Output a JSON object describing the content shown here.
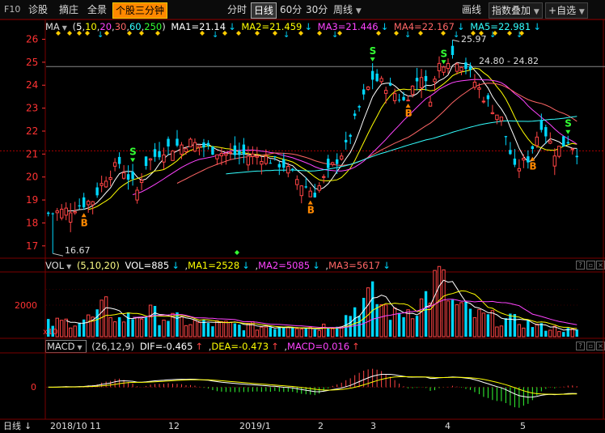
{
  "topbar": {
    "f10": "F10",
    "left_tabs": [
      "诊股",
      "摘庄",
      "全景"
    ],
    "active_tab": "个股三分钟",
    "periods": [
      "分时",
      "日线",
      "60分",
      "30分",
      "周线"
    ],
    "selected_period": "日线",
    "draw_label": "画线",
    "overlay_label": "指数叠加",
    "watchlist_label": "自选"
  },
  "colors": {
    "up": "#ff4444",
    "down": "#00d8ff",
    "ma5": "#ffffff",
    "ma10": "#ffff00",
    "ma20": "#ff44ff",
    "ma30": "#ff6666",
    "ma60": "#33ffff",
    "ma250": "#33ff33",
    "grid": "#7a0000",
    "axis_text": "#ff3333",
    "buy": "#ff8800",
    "sell": "#33ff33"
  },
  "price_panel": {
    "name": "MA",
    "params_prefix": "(",
    "params": [
      "5",
      "10",
      "20",
      "30",
      "60",
      "250"
    ],
    "params_suffix": ")",
    "ma_values": [
      {
        "label": "MA1=21.14"
      },
      {
        "label": "MA2=21.459"
      },
      {
        "label": "MA3=21.446"
      },
      {
        "label": "MA4=22.167"
      },
      {
        "label": "MA5=22.981"
      }
    ],
    "y_ticks": [
      "26",
      "25",
      "24",
      "23",
      "22",
      "21",
      "20",
      "19",
      "18",
      "17"
    ],
    "high_label": "25.97",
    "low_label": "16.67",
    "range_label": "24.80 - 24.82",
    "buy_label": "B",
    "sell_label": "S"
  },
  "vol_panel": {
    "name": "VOL",
    "params": "(5,10,20)",
    "values": [
      "VOL=885",
      "MA1=2528",
      "MA2=5085",
      "MA3=5617"
    ],
    "y_tick": "2000",
    "unit": "x10"
  },
  "macd_panel": {
    "name": "MACD",
    "params": "(26,12,9)",
    "values": [
      "DIF=-0.465",
      "DEA=-0.473",
      "MACD=0.016"
    ],
    "y_tick": "0"
  },
  "bottom": {
    "period_label": "日线",
    "date_labels": [
      "2018/10",
      "11",
      "12",
      "2019/1",
      "2",
      "3",
      "4",
      "5"
    ]
  },
  "chart_data": {
    "type": "candlestick",
    "ylim": [
      16.5,
      26.3
    ],
    "close_anchors": [
      [
        0,
        18.4
      ],
      [
        5,
        18.6
      ],
      [
        10,
        19.0
      ],
      [
        13,
        20.0
      ],
      [
        16,
        20.6
      ],
      [
        20,
        19.4
      ],
      [
        22,
        20.6
      ],
      [
        26,
        21.2
      ],
      [
        32,
        21.5
      ],
      [
        40,
        21.0
      ],
      [
        48,
        20.9
      ],
      [
        53,
        20.5
      ],
      [
        57,
        19.7
      ],
      [
        60,
        19.3
      ],
      [
        63,
        20.2
      ],
      [
        67,
        21.3
      ],
      [
        70,
        23.0
      ],
      [
        73,
        24.3
      ],
      [
        76,
        24.0
      ],
      [
        80,
        23.3
      ],
      [
        84,
        24.5
      ],
      [
        86,
        23.5
      ],
      [
        88,
        24.9
      ],
      [
        91,
        25.3
      ],
      [
        94,
        24.8
      ],
      [
        98,
        23.5
      ],
      [
        102,
        22.5
      ],
      [
        105,
        20.3
      ],
      [
        108,
        20.8
      ],
      [
        111,
        22.3
      ],
      [
        114,
        21.1
      ],
      [
        117,
        21.6
      ],
      [
        119,
        21.1
      ]
    ],
    "vol_ylim": [
      0,
      4500
    ],
    "vol_anchors": [
      [
        0,
        900
      ],
      [
        10,
        1300
      ],
      [
        13,
        2100
      ],
      [
        16,
        1200
      ],
      [
        22,
        1700
      ],
      [
        32,
        1000
      ],
      [
        48,
        700
      ],
      [
        55,
        900
      ],
      [
        60,
        600
      ],
      [
        66,
        1100
      ],
      [
        70,
        2400
      ],
      [
        73,
        2800
      ],
      [
        78,
        1500
      ],
      [
        84,
        2400
      ],
      [
        88,
        4200
      ],
      [
        91,
        2300
      ],
      [
        96,
        1500
      ],
      [
        102,
        1200
      ],
      [
        106,
        1100
      ],
      [
        111,
        700
      ],
      [
        119,
        400
      ]
    ],
    "buy_points": [
      8,
      59,
      81,
      109
    ],
    "sell_points": [
      19,
      73,
      89,
      117
    ]
  }
}
